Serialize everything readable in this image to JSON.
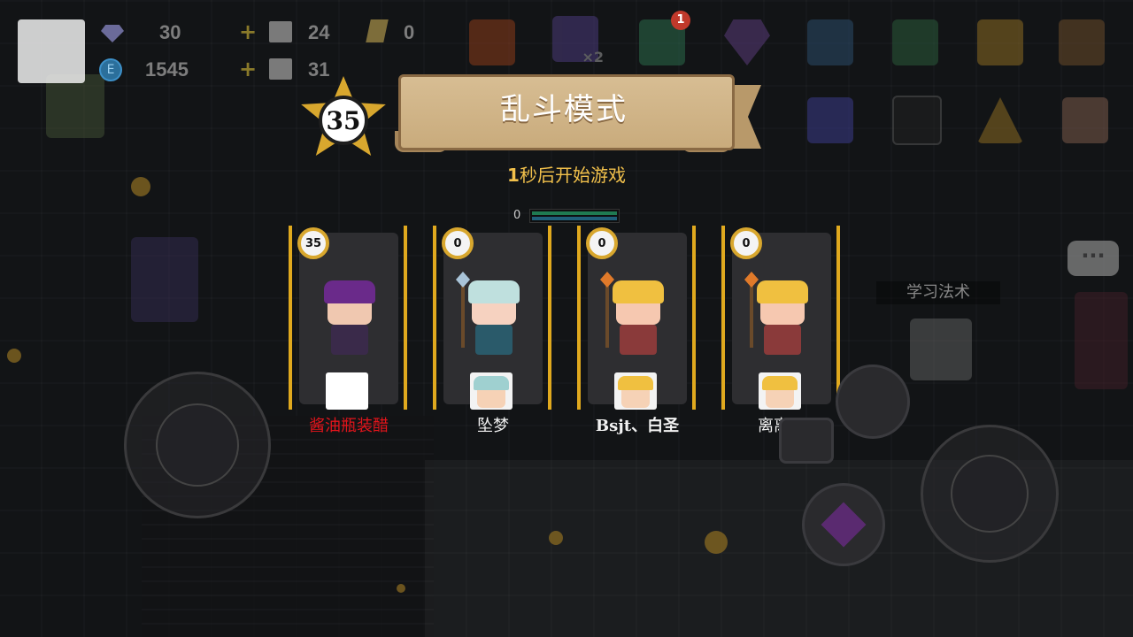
{
  "resources": {
    "gems": "30",
    "coins": "1545",
    "coin_symbol": "E",
    "crates_a": "24",
    "crates_b": "31",
    "scrolls": "0"
  },
  "top_icons": {
    "gift_label": "gift",
    "gem_bag_multiplier": "×2",
    "chest_badge": "1"
  },
  "mode": {
    "title": "乱斗模式",
    "host_level": "35",
    "countdown_number": "1",
    "countdown_text": "秒后开始游戏"
  },
  "players": [
    {
      "level": "35",
      "name": "酱油瓶装醋",
      "is_self": true
    },
    {
      "level": "0",
      "name": "坠梦",
      "is_self": false
    },
    {
      "level": "0",
      "name": "Bsjt、白圣",
      "is_self": false
    },
    {
      "level": "0",
      "name": "离离原",
      "is_self": false
    }
  ],
  "world": {
    "learn_magic_label": "学习法术",
    "hp_value": "0",
    "chat_icon": "···"
  },
  "colors": {
    "accent_gold": "#e0a91e",
    "self_name": "#e4141b",
    "countdown": "#f1c04b"
  }
}
